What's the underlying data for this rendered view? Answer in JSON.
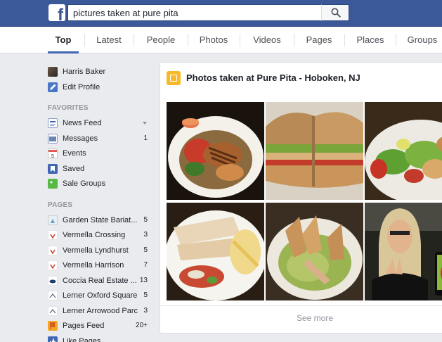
{
  "search": {
    "value": "pictures taken at pure pita",
    "icon": "magnifier-icon"
  },
  "brand": {
    "logo_letter": "f",
    "color": "#3b5998"
  },
  "tabs": [
    {
      "label": "Top",
      "active": true
    },
    {
      "label": "Latest"
    },
    {
      "label": "People"
    },
    {
      "label": "Photos"
    },
    {
      "label": "Videos"
    },
    {
      "label": "Pages"
    },
    {
      "label": "Places"
    },
    {
      "label": "Groups"
    }
  ],
  "sidebar": {
    "profile": [
      {
        "label": "Harris Baker",
        "icon": "avatar-icon"
      },
      {
        "label": "Edit Profile",
        "icon": "pencil-icon"
      }
    ],
    "favorites_heading": "FAVORITES",
    "favorites": [
      {
        "label": "News Feed",
        "icon": "news-feed-icon"
      },
      {
        "label": "Messages",
        "icon": "messages-icon",
        "count": "1"
      },
      {
        "label": "Events",
        "icon": "calendar-icon"
      },
      {
        "label": "Saved",
        "icon": "bookmark-icon"
      },
      {
        "label": "Sale Groups",
        "icon": "tag-icon"
      }
    ],
    "pages_heading": "PAGES",
    "pages": [
      {
        "label": "Garden State Bariat...",
        "count": "5"
      },
      {
        "label": "Vermella Crossing",
        "count": "3"
      },
      {
        "label": "Vermella Lyndhurst",
        "count": "5"
      },
      {
        "label": "Vermella Harrison",
        "count": "7"
      },
      {
        "label": "Coccia Real Estate ...",
        "count": "13"
      },
      {
        "label": "Lerner Oxford Square",
        "count": "5"
      },
      {
        "label": "Lerner Arrowood Parc",
        "count": "3"
      },
      {
        "label": "Pages Feed",
        "count": "20+"
      },
      {
        "label": "Like Pages"
      }
    ]
  },
  "card": {
    "title": "Photos taken at Pure Pita - Hoboken, NJ",
    "see_more": "See more",
    "photos": [
      {
        "name": "plate-with-grilled-chicken-photo"
      },
      {
        "name": "sandwich-photo"
      },
      {
        "name": "salad-photo"
      },
      {
        "name": "wraps-with-corn-photo"
      },
      {
        "name": "green-dip-with-pita-photo"
      },
      {
        "name": "man-with-long-hair-photo"
      }
    ]
  }
}
